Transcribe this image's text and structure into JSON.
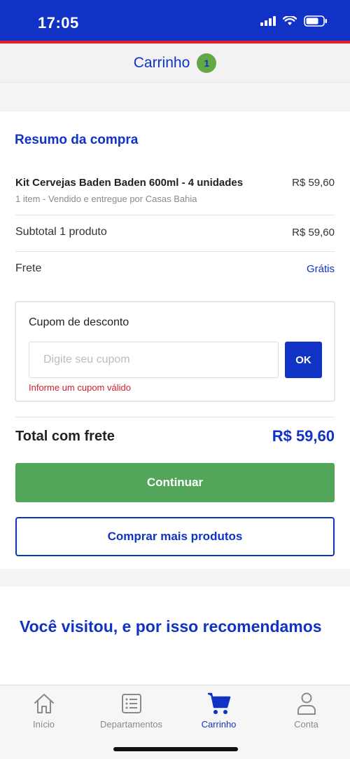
{
  "status_bar": {
    "time": "17:05"
  },
  "header": {
    "title": "Carrinho",
    "badge_count": "1"
  },
  "summary": {
    "title": "Resumo da compra",
    "item": {
      "name": "Kit Cervejas Baden Baden 600ml - 4 unidades",
      "price": "R$ 59,60",
      "subtitle": "1 item - Vendido e entregue por Casas Bahia"
    },
    "subtotal": {
      "label": "Subtotal 1 produto",
      "value": "R$ 59,60"
    },
    "shipping": {
      "label": "Frete",
      "value": "Grátis"
    }
  },
  "coupon": {
    "title": "Cupom de desconto",
    "placeholder": "Digite seu cupom",
    "ok_label": "OK",
    "error": "Informe um cupom válido"
  },
  "total": {
    "label": "Total com frete",
    "value": "R$ 59,60"
  },
  "actions": {
    "continue": "Continuar",
    "more": "Comprar mais produtos"
  },
  "recommendations": {
    "title": "Você visitou, e por isso recomendamos"
  },
  "tabbar": {
    "tabs": [
      {
        "label": "Início",
        "icon": "home-icon"
      },
      {
        "label": "Departamentos",
        "icon": "list-icon"
      },
      {
        "label": "Carrinho",
        "icon": "cart-icon",
        "active": true
      },
      {
        "label": "Conta",
        "icon": "user-icon"
      }
    ]
  },
  "colors": {
    "brand_blue": "#1133c5",
    "green": "#53a55a",
    "error_red": "#d11f2f",
    "badge_green": "#62a845"
  }
}
